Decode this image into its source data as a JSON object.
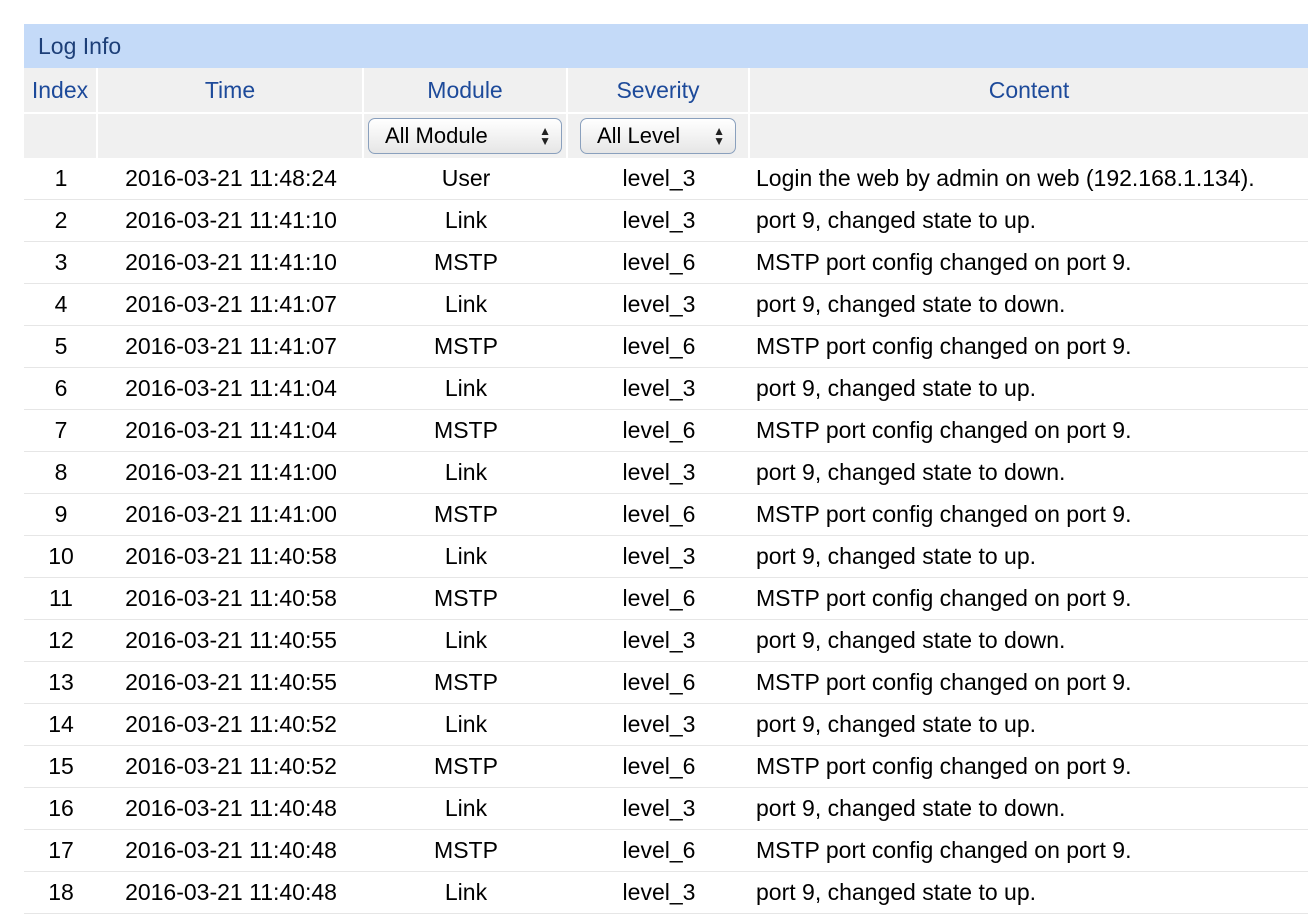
{
  "title": "Log Info",
  "columns": {
    "index": "Index",
    "time": "Time",
    "module": "Module",
    "severity": "Severity",
    "content": "Content"
  },
  "filters": {
    "module": "All Module",
    "level": "All Level"
  },
  "rows": [
    {
      "index": "1",
      "time": "2016-03-21 11:48:24",
      "module": "User",
      "severity": "level_3",
      "content": "Login the web by admin on web (192.168.1.134)."
    },
    {
      "index": "2",
      "time": "2016-03-21 11:41:10",
      "module": "Link",
      "severity": "level_3",
      "content": "port 9, changed state to up."
    },
    {
      "index": "3",
      "time": "2016-03-21 11:41:10",
      "module": "MSTP",
      "severity": "level_6",
      "content": "MSTP port config changed on port 9."
    },
    {
      "index": "4",
      "time": "2016-03-21 11:41:07",
      "module": "Link",
      "severity": "level_3",
      "content": "port 9, changed state to down."
    },
    {
      "index": "5",
      "time": "2016-03-21 11:41:07",
      "module": "MSTP",
      "severity": "level_6",
      "content": "MSTP port config changed on port 9."
    },
    {
      "index": "6",
      "time": "2016-03-21 11:41:04",
      "module": "Link",
      "severity": "level_3",
      "content": "port 9, changed state to up."
    },
    {
      "index": "7",
      "time": "2016-03-21 11:41:04",
      "module": "MSTP",
      "severity": "level_6",
      "content": "MSTP port config changed on port 9."
    },
    {
      "index": "8",
      "time": "2016-03-21 11:41:00",
      "module": "Link",
      "severity": "level_3",
      "content": "port 9, changed state to down."
    },
    {
      "index": "9",
      "time": "2016-03-21 11:41:00",
      "module": "MSTP",
      "severity": "level_6",
      "content": "MSTP port config changed on port 9."
    },
    {
      "index": "10",
      "time": "2016-03-21 11:40:58",
      "module": "Link",
      "severity": "level_3",
      "content": "port 9, changed state to up."
    },
    {
      "index": "11",
      "time": "2016-03-21 11:40:58",
      "module": "MSTP",
      "severity": "level_6",
      "content": "MSTP port config changed on port 9."
    },
    {
      "index": "12",
      "time": "2016-03-21 11:40:55",
      "module": "Link",
      "severity": "level_3",
      "content": "port 9, changed state to down."
    },
    {
      "index": "13",
      "time": "2016-03-21 11:40:55",
      "module": "MSTP",
      "severity": "level_6",
      "content": "MSTP port config changed on port 9."
    },
    {
      "index": "14",
      "time": "2016-03-21 11:40:52",
      "module": "Link",
      "severity": "level_3",
      "content": "port 9, changed state to up."
    },
    {
      "index": "15",
      "time": "2016-03-21 11:40:52",
      "module": "MSTP",
      "severity": "level_6",
      "content": "MSTP port config changed on port 9."
    },
    {
      "index": "16",
      "time": "2016-03-21 11:40:48",
      "module": "Link",
      "severity": "level_3",
      "content": "port 9, changed state to down."
    },
    {
      "index": "17",
      "time": "2016-03-21 11:40:48",
      "module": "MSTP",
      "severity": "level_6",
      "content": "MSTP port config changed on port 9."
    },
    {
      "index": "18",
      "time": "2016-03-21 11:40:48",
      "module": "Link",
      "severity": "level_3",
      "content": "port 9, changed state to up."
    }
  ]
}
